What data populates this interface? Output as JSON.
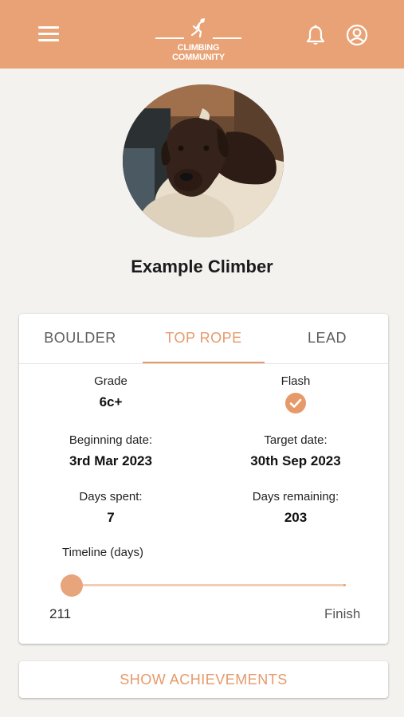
{
  "header": {
    "logo_text": "CLIMBING COMMUNITY",
    "background_color": "#e9a275",
    "icons": [
      "menu-icon",
      "climber-logo-icon",
      "bell-icon",
      "account-circle-icon"
    ]
  },
  "profile": {
    "name": "Example Climber",
    "photo": "dog-photo"
  },
  "tabs": [
    {
      "label": "BOULDER",
      "active": false
    },
    {
      "label": "TOP ROPE",
      "active": true
    },
    {
      "label": "LEAD",
      "active": false
    }
  ],
  "stats": {
    "grade_label": "Grade",
    "grade_value": "6c+",
    "flash_label": "Flash",
    "flash_checked": true,
    "beginning_label": "Beginning date:",
    "beginning_value": "3rd Mar 2023",
    "target_label": "Target date:",
    "target_value": "30th Sep 2023",
    "days_spent_label": "Days spent:",
    "days_spent_value": "7",
    "days_remaining_label": "Days remaining:",
    "days_remaining_value": "203"
  },
  "timeline": {
    "label": "Timeline (days)",
    "start_label": "211",
    "end_label": "Finish",
    "progress": 0
  },
  "actions": {
    "show_achievements": "SHOW ACHIEVEMENTS"
  },
  "colors": {
    "accent": "#e69a6a",
    "background": "#f3f2ef"
  }
}
